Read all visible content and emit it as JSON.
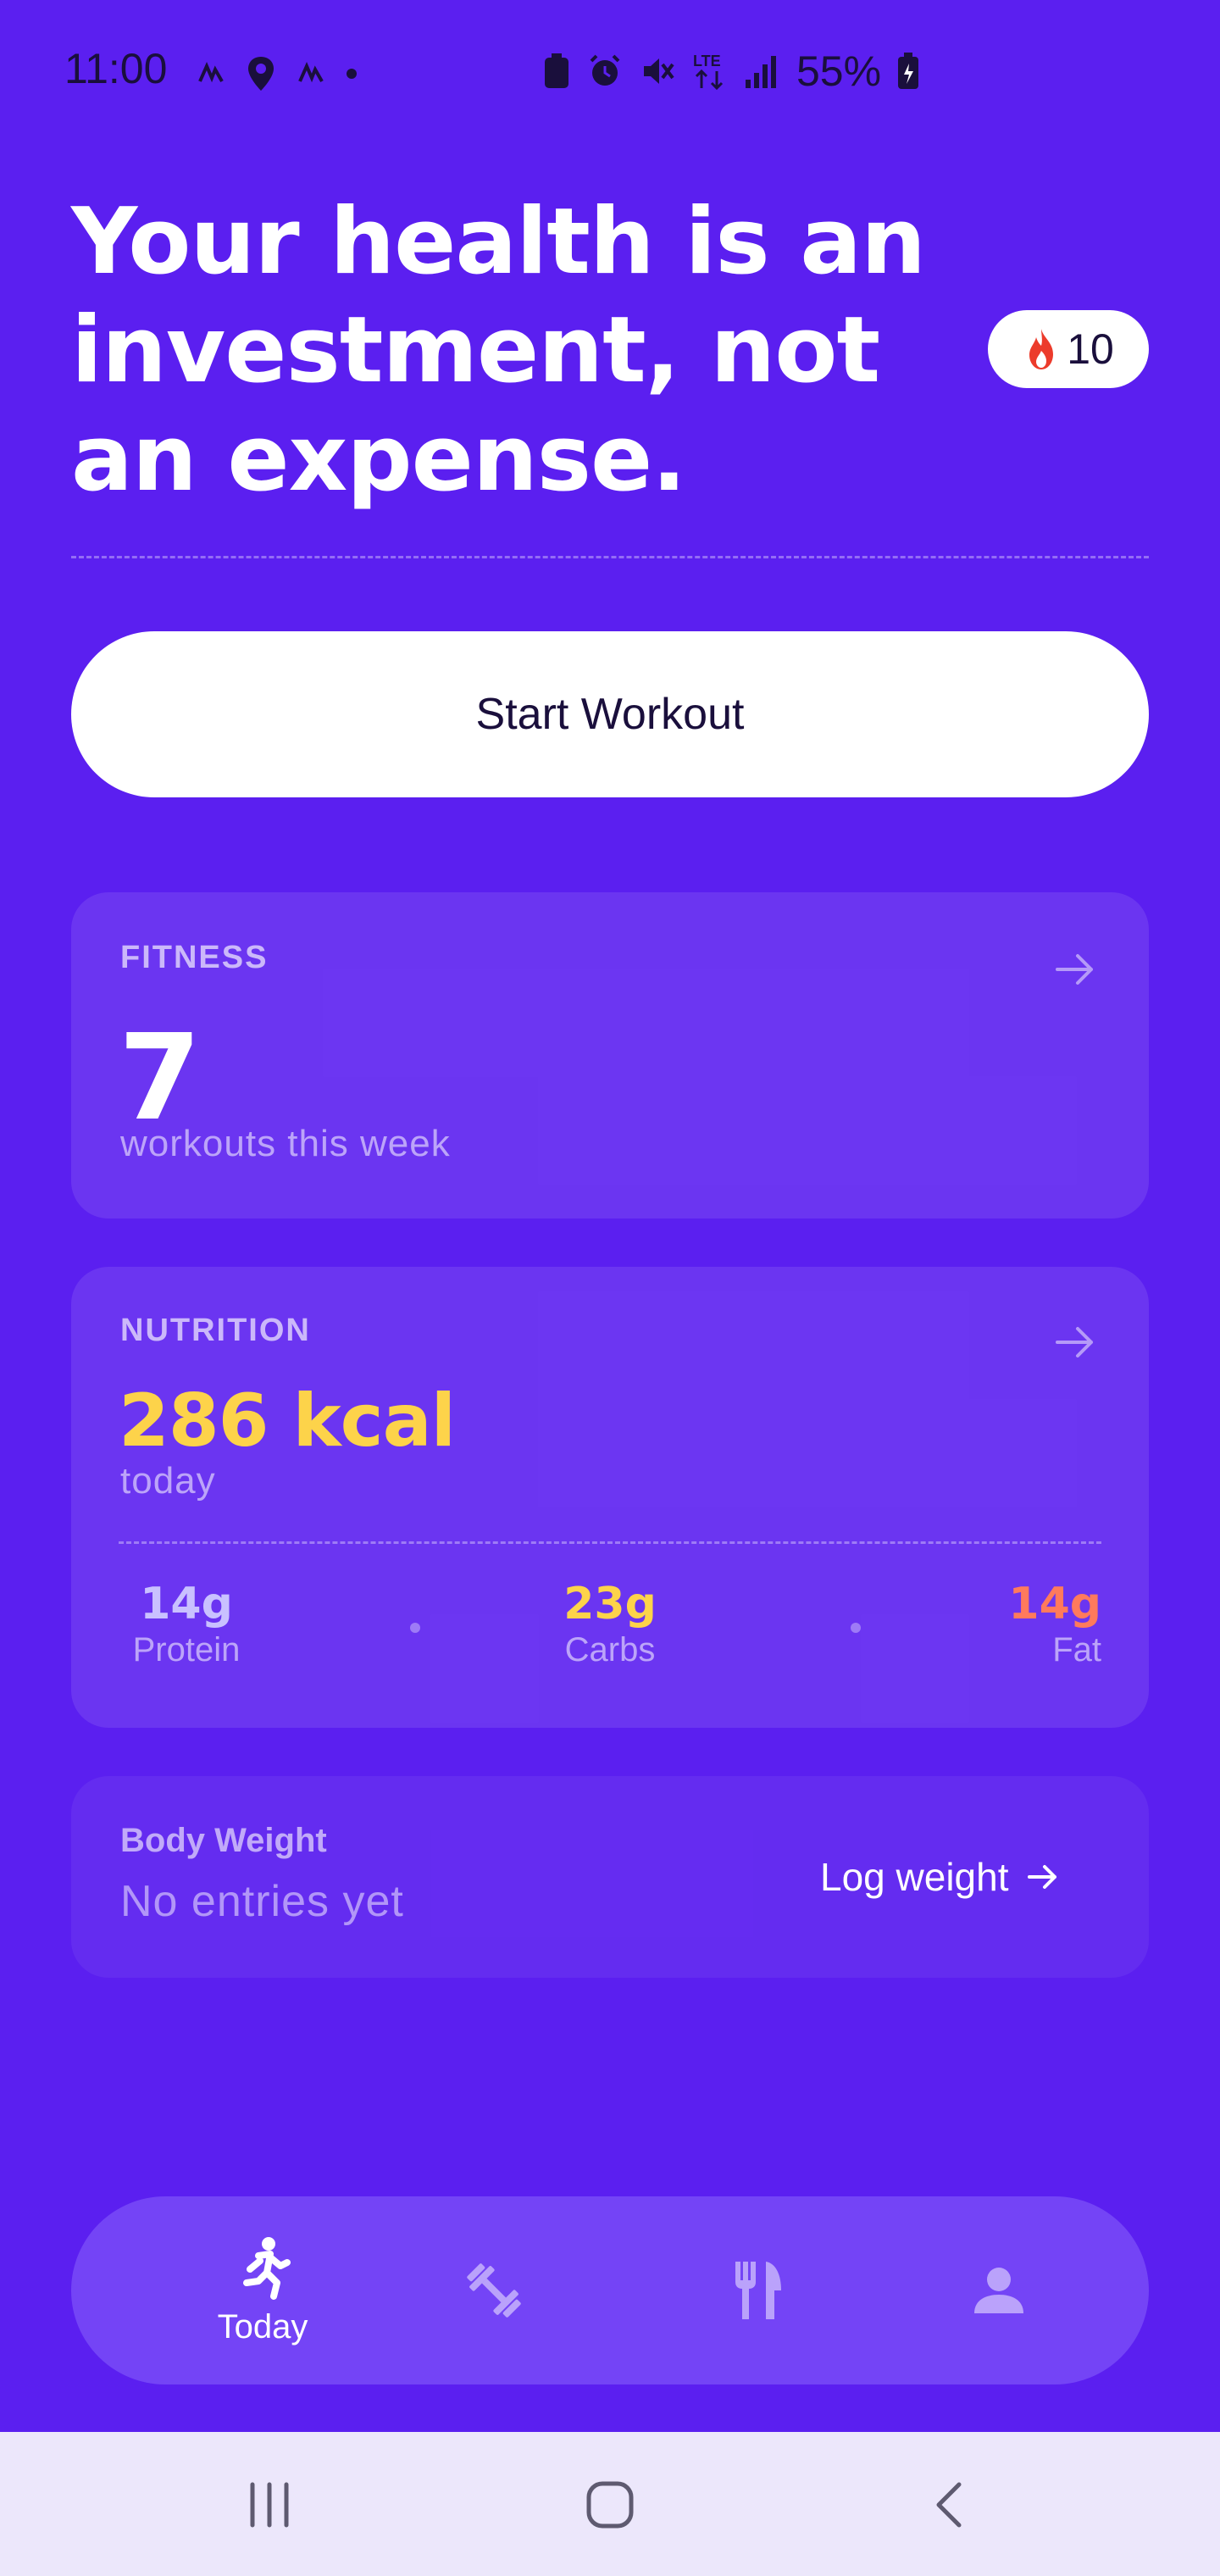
{
  "status_bar": {
    "time": "11:00",
    "battery": "55%",
    "network": "LTE"
  },
  "header": {
    "headline": "Your health is an investment, not an expense.",
    "streak_count": "10",
    "streak_icon": "flame-icon"
  },
  "actions": {
    "start_workout_label": "Start Workout"
  },
  "fitness": {
    "label": "FITNESS",
    "count": "7",
    "caption": "workouts this week"
  },
  "nutrition": {
    "label": "NUTRITION",
    "kcal": "286 kcal",
    "caption": "today",
    "macros": [
      {
        "value": "14g",
        "label": "Protein",
        "color": "#c9c1ff"
      },
      {
        "value": "23g",
        "label": "Carbs",
        "color": "#fdd34a"
      },
      {
        "value": "14g",
        "label": "Fat",
        "color": "#ff7a5c"
      }
    ]
  },
  "body_weight": {
    "title": "Body Weight",
    "status": "No entries yet",
    "action_label": "Log weight"
  },
  "bottom_nav": {
    "items": [
      {
        "label": "Today",
        "icon": "running-icon",
        "active": true
      },
      {
        "label": "",
        "icon": "dumbbell-icon",
        "active": false
      },
      {
        "label": "",
        "icon": "fork-knife-icon",
        "active": false
      },
      {
        "label": "",
        "icon": "person-icon",
        "active": false
      }
    ]
  },
  "colors": {
    "background": "#5b1ff0",
    "accent_kcal": "#fdd34a",
    "nav_bar": "#7444f6"
  }
}
